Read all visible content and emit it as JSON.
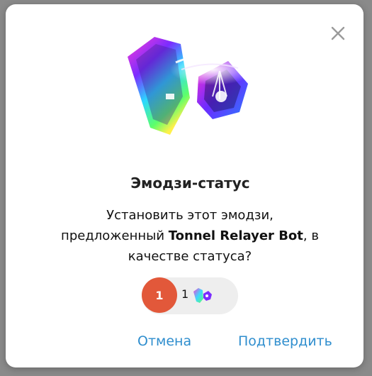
{
  "dialog": {
    "close_icon": "close-icon",
    "artwork_icon": "crystal-emoji-icon",
    "title": "Эмодзи-статус",
    "description_before": "Установить этот эмодзи, предложенный ",
    "bot_name": "Tonnel Relayer Bot",
    "description_after": ", в качестве статуса?",
    "reaction": {
      "badge_count": "1",
      "emoji_count": "1",
      "emoji_icon": "crystal-emoji-icon"
    },
    "cancel_label": "Отмена",
    "confirm_label": "Подтвердить"
  },
  "colors": {
    "accent": "#2f8ece",
    "badge": "#e2583a",
    "pill_bg": "#eeeeee"
  }
}
